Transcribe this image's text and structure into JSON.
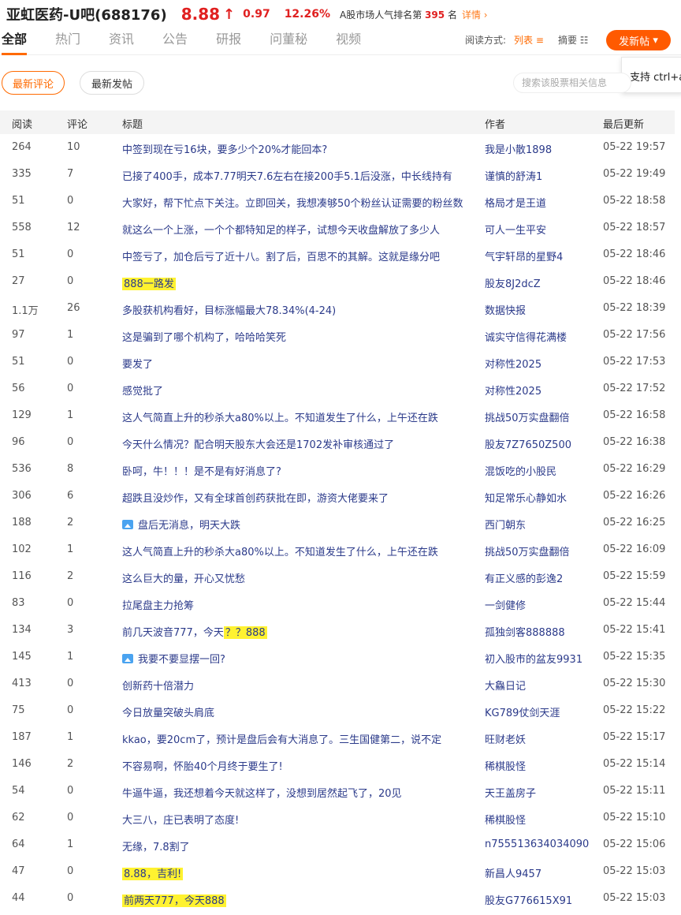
{
  "header": {
    "title": "亚虹医药-U吧(688176)",
    "price": "8.88",
    "arrow": "↑",
    "change": "0.97",
    "percent": "12.26%",
    "rank_prefix": "A股市场人气排名第",
    "rank_num": "395",
    "rank_suffix": "名",
    "detail": "详情",
    "accent_color": "#e02020"
  },
  "tabs": [
    "全部",
    "热门",
    "资讯",
    "公告",
    "研报",
    "问董秘",
    "视频"
  ],
  "view_mode": {
    "label": "阅读方式:",
    "list": "列表",
    "summary": "摘要"
  },
  "post_button": "发新帖",
  "tooltip": "支持 ctrl+a",
  "filters": {
    "latest_comment": "最新评论",
    "latest_post": "最新发帖"
  },
  "search": {
    "placeholder": "搜索该股票相关信息"
  },
  "table": {
    "headers": {
      "read": "阅读",
      "comment": "评论",
      "title": "标题",
      "author": "作者",
      "updated": "最后更新"
    },
    "rows": [
      {
        "read": "264",
        "comment": "10",
        "title": "中签到现在亏16块，要多少个20%才能回本?",
        "author": "我是小散1898",
        "time": "05-22 19:57"
      },
      {
        "read": "335",
        "comment": "7",
        "title": "已接了400手，成本7.77明天7.6左右在接200手5.1后没涨，中长线持有",
        "author": "谨慎的舒涛1",
        "time": "05-22 19:49"
      },
      {
        "read": "51",
        "comment": "0",
        "title": "大家好，帮下忙点下关注。立即回关，我想凑够50个粉丝认证需要的粉丝数",
        "author": "格局才是王道",
        "time": "05-22 18:58"
      },
      {
        "read": "558",
        "comment": "12",
        "title": "就这么一个上涨，一个个都特知足的样子，试想今天收盘解放了多少人",
        "author": "可人一生平安",
        "time": "05-22 18:57"
      },
      {
        "read": "51",
        "comment": "0",
        "title": "中签亏了，加仓后亏了近十八。割了后，百思不的其解。这就是缘分吧",
        "author": "气宇轩昂的星野4",
        "time": "05-22 18:46"
      },
      {
        "read": "27",
        "comment": "0",
        "title": "888一路发",
        "author": "股友8J2dcZ",
        "time": "05-22 18:46",
        "highlight": true
      },
      {
        "read": "1.1万",
        "comment": "26",
        "title": "多股获机构看好，目标涨幅最大78.34%(4-24)",
        "author": "数据快报",
        "time": "05-22 18:39"
      },
      {
        "read": "97",
        "comment": "1",
        "title": "这是骗到了哪个机构了，哈哈哈笑死",
        "author": "诚实守信得花满楼",
        "time": "05-22 17:56"
      },
      {
        "read": "51",
        "comment": "0",
        "title": "要发了",
        "author": "对称性2025",
        "time": "05-22 17:53"
      },
      {
        "read": "56",
        "comment": "0",
        "title": "感觉批了",
        "author": "对称性2025",
        "time": "05-22 17:52"
      },
      {
        "read": "129",
        "comment": "1",
        "title": "这人气简直上升的秒杀大a80%以上。不知道发生了什么，上午还在跌",
        "author": "挑战50万实盘翻倍",
        "time": "05-22 16:58"
      },
      {
        "read": "96",
        "comment": "0",
        "title": "今天什么情况？配合明天股东大会还是1702发补审核通过了",
        "author": "股友7Z7650Z500",
        "time": "05-22 16:38"
      },
      {
        "read": "536",
        "comment": "8",
        "title": "卧呵，牛！！！是不是有好消息了?",
        "author": "混饭吃的小股民",
        "time": "05-22 16:29"
      },
      {
        "read": "306",
        "comment": "6",
        "title": "超跌且没炒作，又有全球首创药获批在即，游资大佬要来了",
        "author": "知足常乐心静如水",
        "time": "05-22 16:26"
      },
      {
        "read": "188",
        "comment": "2",
        "title": "盘后无消息，明天大跌",
        "author": "西门朝东",
        "time": "05-22 16:25",
        "image": true
      },
      {
        "read": "102",
        "comment": "1",
        "title": "这人气简直上升的秒杀大a80%以上。不知道发生了什么，上午还在跌",
        "author": "挑战50万实盘翻倍",
        "time": "05-22 16:09"
      },
      {
        "read": "116",
        "comment": "2",
        "title": "这么巨大的量，开心又忧愁",
        "author": "有正义感的彭逸2",
        "time": "05-22 15:59"
      },
      {
        "read": "83",
        "comment": "0",
        "title": "拉尾盘主力抢筹",
        "author": "一剑健修",
        "time": "05-22 15:44"
      },
      {
        "read": "134",
        "comment": "3",
        "title_pre": "前几天波音777，今天",
        "title_hl": "？？888",
        "author": "孤独剑客888888",
        "time": "05-22 15:41"
      },
      {
        "read": "145",
        "comment": "1",
        "title": "我要不要显摆一回?",
        "author": "初入股市的盆友9931",
        "time": "05-22 15:35",
        "image": true
      },
      {
        "read": "413",
        "comment": "0",
        "title": "创新药十倍潜力",
        "author": "大鱻日记",
        "time": "05-22 15:30"
      },
      {
        "read": "75",
        "comment": "0",
        "title": "今日放量突破头肩底",
        "author": "KG789仗剑天涯",
        "time": "05-22 15:22"
      },
      {
        "read": "187",
        "comment": "1",
        "title": "kkao，要20cm了，预计是盘后会有大消息了。三生国健第二，说不定",
        "author": "旺财老妖",
        "time": "05-22 15:17"
      },
      {
        "read": "146",
        "comment": "2",
        "title": "不容易啊，怀胎40个月终于要生了!",
        "author": "稀棋股怪",
        "time": "05-22 15:14"
      },
      {
        "read": "54",
        "comment": "0",
        "title": "牛逼牛逼，我还想着今天就这样了，没想到居然起飞了，20见",
        "author": "天王盖房子",
        "time": "05-22 15:11"
      },
      {
        "read": "62",
        "comment": "0",
        "title": "大三八，庄已表明了态度!",
        "author": "稀棋股怪",
        "time": "05-22 15:10"
      },
      {
        "read": "64",
        "comment": "1",
        "title": "无缘，7.8割了",
        "author": "n755513634034090",
        "time": "05-22 15:06"
      },
      {
        "read": "47",
        "comment": "0",
        "title": "8.88，吉利!",
        "author": "新昌人9457",
        "time": "05-22 15:03",
        "highlight": true
      },
      {
        "read": "44",
        "comment": "0",
        "title": "前两天777，今天888",
        "author": "股友G776615X91",
        "time": "05-22 15:03",
        "highlight": true
      }
    ]
  }
}
